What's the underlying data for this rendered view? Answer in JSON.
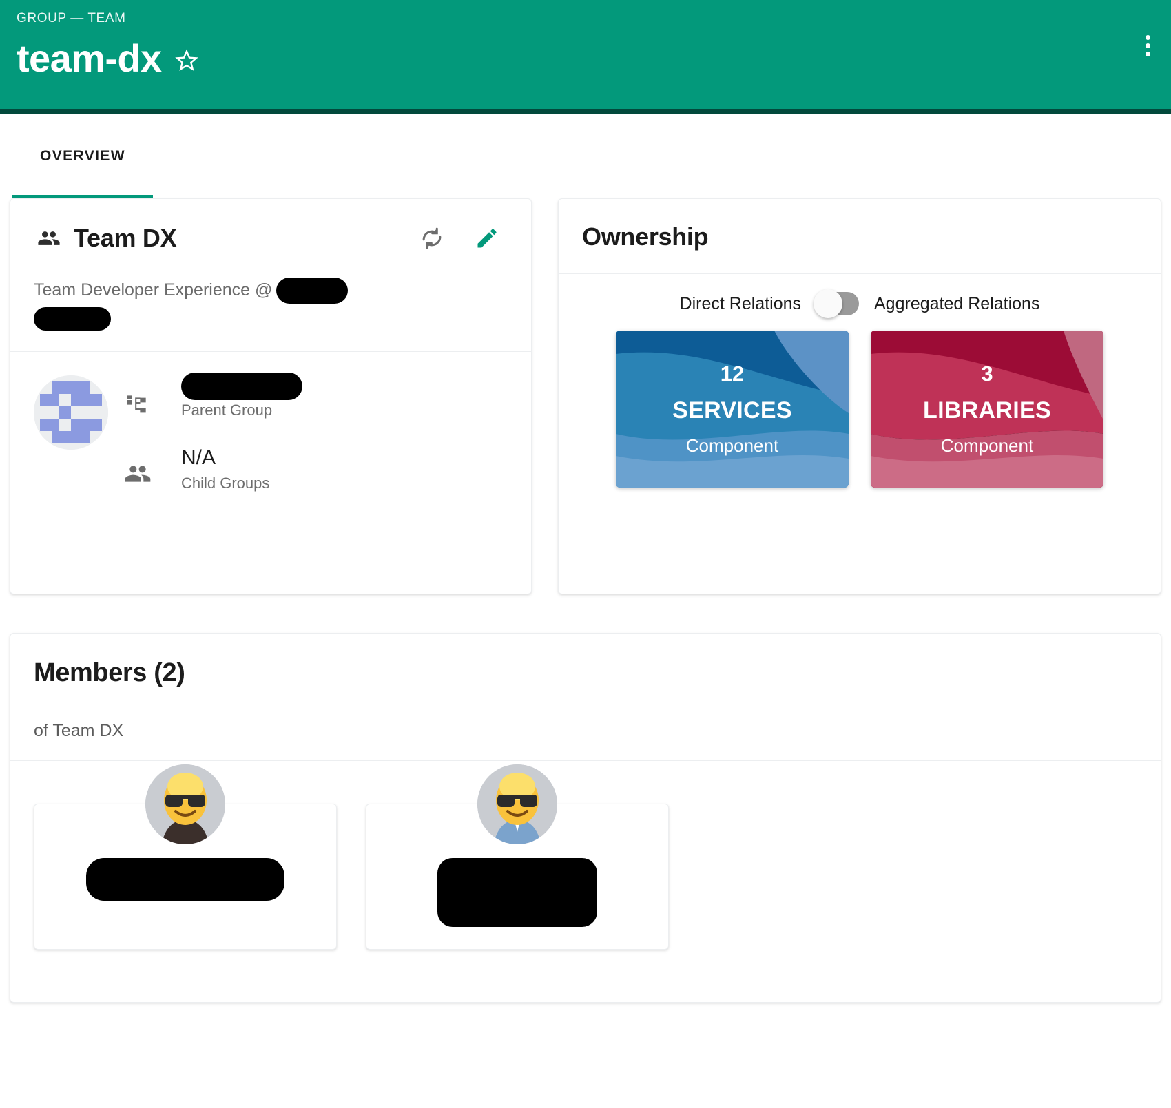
{
  "header": {
    "breadcrumb": "GROUP — TEAM",
    "title": "team-dx",
    "star_icon": "star-outline-icon",
    "menu_icon": "more-vert-icon",
    "bg_color": "#03997b",
    "accent_underline": "#02493c"
  },
  "tabs": [
    {
      "label": "OVERVIEW",
      "active": true
    }
  ],
  "about": {
    "icon": "group-people-icon",
    "title": "Team DX",
    "refresh_icon": "sync-refresh-icon",
    "edit_icon": "pencil-edit-icon",
    "description_prefix": "Team Developer Experience @",
    "description_redacted_1": "",
    "description_redacted_2": "",
    "avatar_icon": "identicon-avatar",
    "fields": [
      {
        "icon": "account-tree-icon",
        "value": "",
        "value_redacted": true,
        "label": "Parent Group"
      },
      {
        "icon": "people-icon",
        "value": "N/A",
        "value_redacted": false,
        "label": "Child Groups"
      }
    ]
  },
  "ownership": {
    "title": "Ownership",
    "toggle": {
      "left_label": "Direct Relations",
      "right_label": "Aggregated Relations",
      "state": "off",
      "track_color": "#9a9a9a",
      "knob_color": "#fafafa"
    },
    "tiles": [
      {
        "count": "12",
        "kind": "SERVICES",
        "type": "Component",
        "color": "#2f7eb4",
        "color_dark": "#0d5c96",
        "color_mid": "#2a83b5",
        "color_light": "#6ba2d0"
      },
      {
        "count": "3",
        "kind": "LIBRARIES",
        "type": "Component",
        "color": "#bb2b50",
        "color_dark": "#9c0c36",
        "color_mid": "#bf3257",
        "color_light": "#cc6c86"
      }
    ]
  },
  "members": {
    "title": "Members (2)",
    "subtitle": "of Team DX",
    "list": [
      {
        "avatar_icon": "sunglasses-emoji-avatar-dark",
        "name": "",
        "name_redacted": true
      },
      {
        "avatar_icon": "sunglasses-emoji-avatar-blue",
        "name": "",
        "name_redacted": true
      }
    ]
  }
}
